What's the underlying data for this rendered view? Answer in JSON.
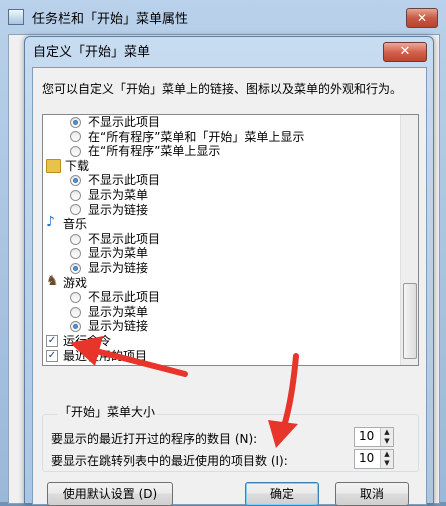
{
  "outer_window": {
    "title": "任务栏和「开始」菜单属性",
    "close_glyph": "✕"
  },
  "dialog": {
    "title": "自定义「开始」菜单",
    "close_glyph": "✕",
    "description": "您可以自定义「开始」菜单上的链接、图标以及菜单的外观和行为。"
  },
  "option_list": {
    "rows": [
      {
        "type": "radio",
        "label": "不显示此项目",
        "checked": true
      },
      {
        "type": "radio",
        "label": "在“所有程序”菜单和「开始」菜单上显示",
        "checked": false
      },
      {
        "type": "radio",
        "label": "在“所有程序”菜单上显示",
        "checked": false
      },
      {
        "type": "category",
        "label": "下载",
        "icon": "folder-icon"
      },
      {
        "type": "radio",
        "label": "不显示此项目",
        "checked": true
      },
      {
        "type": "radio",
        "label": "显示为菜单",
        "checked": false
      },
      {
        "type": "radio",
        "label": "显示为链接",
        "checked": false
      },
      {
        "type": "category",
        "label": "音乐",
        "icon": "music-icon"
      },
      {
        "type": "radio",
        "label": "不显示此项目",
        "checked": false
      },
      {
        "type": "radio",
        "label": "显示为菜单",
        "checked": false
      },
      {
        "type": "radio",
        "label": "显示为链接",
        "checked": true
      },
      {
        "type": "category",
        "label": "游戏",
        "icon": "games-icon"
      },
      {
        "type": "radio",
        "label": "不显示此项目",
        "checked": false
      },
      {
        "type": "radio",
        "label": "显示为菜单",
        "checked": false
      },
      {
        "type": "radio",
        "label": "显示为链接",
        "checked": true
      },
      {
        "type": "checkbox",
        "label": "运行命令",
        "checked": true
      },
      {
        "type": "checkbox",
        "label": "最近使用的项目",
        "checked": true
      }
    ]
  },
  "size_group": {
    "legend": "「开始」菜单大小",
    "recent_programs_label": "要显示的最近打开过的程序的数目 (N):",
    "recent_programs_value": "10",
    "jumplist_label": "要显示在跳转列表中的最近使用的项目数 (I):",
    "jumplist_value": "10"
  },
  "buttons": {
    "use_defaults": "使用默认设置 (D)",
    "ok": "确定",
    "cancel": "取消"
  },
  "colors": {
    "annotation_arrow": "#e8352b",
    "window_frame": "#a9c6e4"
  }
}
